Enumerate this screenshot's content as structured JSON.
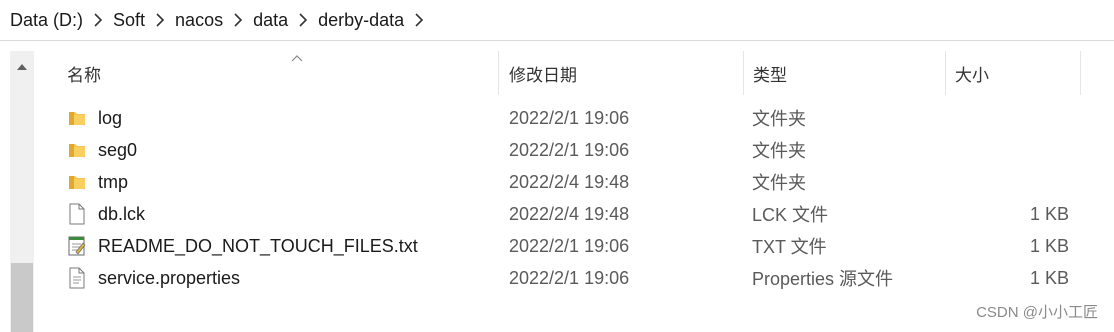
{
  "breadcrumb": [
    "Data (D:)",
    "Soft",
    "nacos",
    "data",
    "derby-data"
  ],
  "columns": {
    "name": "名称",
    "modified": "修改日期",
    "type": "类型",
    "size": "大小"
  },
  "files": [
    {
      "name": "log",
      "modified": "2022/2/1 19:06",
      "type": "文件夹",
      "size": "",
      "icon": "folder-icon"
    },
    {
      "name": "seg0",
      "modified": "2022/2/1 19:06",
      "type": "文件夹",
      "size": "",
      "icon": "folder-icon"
    },
    {
      "name": "tmp",
      "modified": "2022/2/4 19:48",
      "type": "文件夹",
      "size": "",
      "icon": "folder-icon"
    },
    {
      "name": "db.lck",
      "modified": "2022/2/4 19:48",
      "type": "LCK 文件",
      "size": "1 KB",
      "icon": "file-icon"
    },
    {
      "name": "README_DO_NOT_TOUCH_FILES.txt",
      "modified": "2022/2/1 19:06",
      "type": "TXT 文件",
      "size": "1 KB",
      "icon": "text-file-icon"
    },
    {
      "name": "service.properties",
      "modified": "2022/2/1 19:06",
      "type": "Properties 源文件",
      "size": "1 KB",
      "icon": "properties-file-icon"
    }
  ],
  "watermark": "CSDN @小小工匠",
  "colors": {
    "folder": "#f7c34a",
    "folder_dark": "#e0a82e",
    "scroll_thumb": "#c9c9c9"
  }
}
